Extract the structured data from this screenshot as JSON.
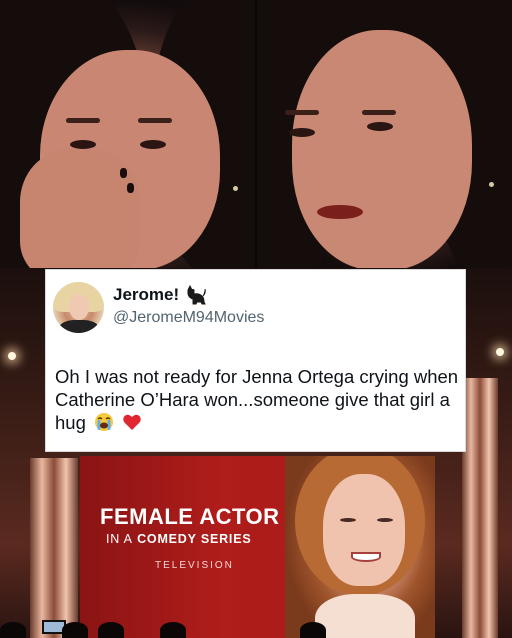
{
  "tweet": {
    "display_name": "Jerome!",
    "name_icon": "black-cat-icon",
    "handle": "@JeromeM94Movies",
    "text": "Oh I was not ready for Jenna Ortega crying when Catherine O’Hara won...someone give that girl a hug",
    "emojis": [
      "loudly-crying-face-icon",
      "red-heart-icon"
    ]
  },
  "stage_screen": {
    "title": "FEMALE ACTOR",
    "subtitle_prefix": "IN A",
    "subtitle_rest": "COMEDY SERIES",
    "category": "TELEVISION"
  },
  "colors": {
    "screen_red": "#a81a18",
    "tweet_bg": "#ffffff",
    "handle_gray": "#536471",
    "text_dark": "#0f1419"
  }
}
